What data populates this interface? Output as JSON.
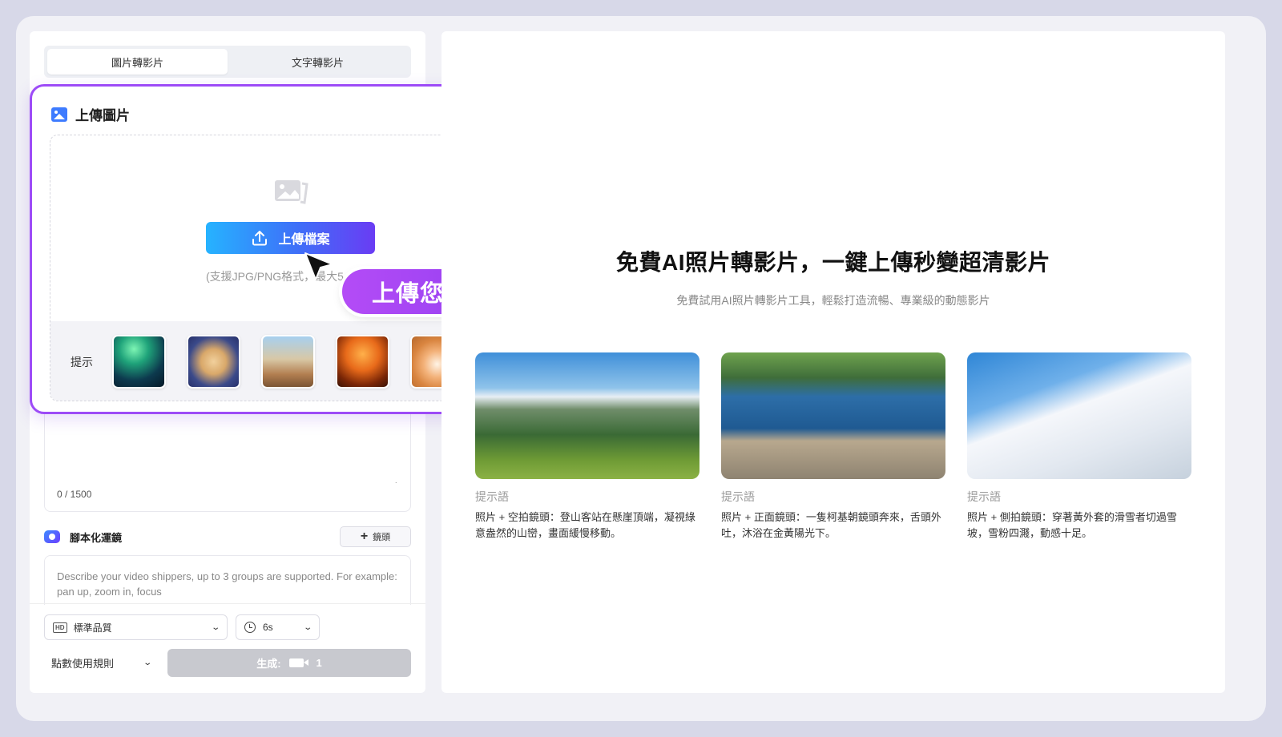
{
  "tabs": [
    {
      "label": "圖片轉影片",
      "active": true
    },
    {
      "label": "文字轉影片",
      "active": false
    }
  ],
  "upload": {
    "title": "上傳圖片",
    "button_label": "上傳檔案",
    "support_text": "(支援JPG/PNG格式，最大5",
    "hints_label": "提示",
    "hint_thumbs": [
      "aurora",
      "bear",
      "bike",
      "perfume",
      "cat"
    ],
    "callout": "上傳您的圖片"
  },
  "prompt": {
    "char_count": "0 / 1500"
  },
  "camera": {
    "title": "腳本化運鏡",
    "add_button": "鏡頭",
    "placeholder": "Describe your video shippers, up to 3 groups are supported. For example: pan up, zoom in, focus"
  },
  "controls": {
    "quality": "標準品質",
    "duration": "6s",
    "rules": "點數使用規則",
    "generate_label": "生成:",
    "generate_cost": "1"
  },
  "hero": {
    "title": "免費AI照片轉影片，一鍵上傳秒變超清影片",
    "subtitle": "免費試用AI照片轉影片工具，輕鬆打造流暢、專業級的動態影片"
  },
  "examples": [
    {
      "label": "提示語",
      "desc": "照片 + 空拍鏡頭：登山客站在懸崖頂端，凝視綠意盎然的山巒，畫面緩慢移動。",
      "image": "mountain"
    },
    {
      "label": "提示語",
      "desc": "照片 + 正面鏡頭：一隻柯基朝鏡頭奔來，舌頭外吐，沐浴在金黃陽光下。",
      "image": "corgi"
    },
    {
      "label": "提示語",
      "desc": "照片 + 側拍鏡頭：穿著黃外套的滑雪者切過雪坡，雪粉四濺，動感十足。",
      "image": "ski"
    }
  ],
  "colors": {
    "accent_purple": "#9d4bf7",
    "upload_gradient_start": "#26b3ff",
    "upload_gradient_end": "#6a3cf4",
    "frame_bg": "#d7d8e8"
  }
}
